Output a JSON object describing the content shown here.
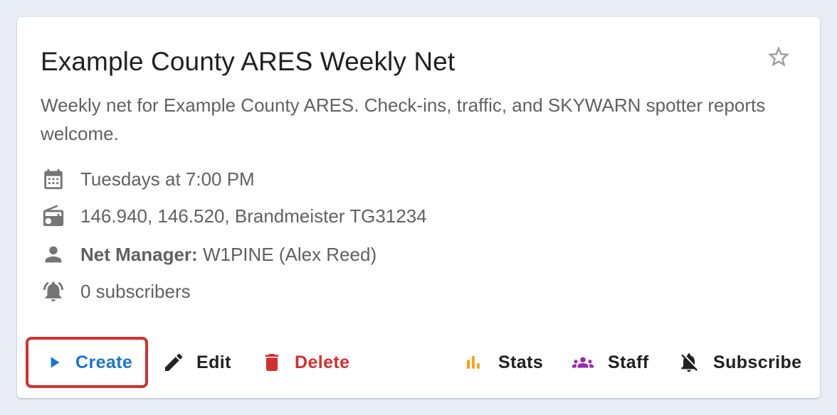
{
  "card": {
    "title": "Example County ARES Weekly Net",
    "description": "Weekly net for Example County ARES. Check-ins, traffic, and SKYWARN spotter reports welcome.",
    "schedule": "Tuesdays at 7:00 PM",
    "frequencies": "146.940, 146.520, Brandmeister TG31234",
    "manager_label": "Net Manager:",
    "manager_value": "W1PINE (Alex Reed)",
    "subscribers": "0 subscribers",
    "favorite_icon": "star-outline-icon"
  },
  "actions": {
    "create": "Create",
    "edit": "Edit",
    "delete": "Delete",
    "stats": "Stats",
    "staff": "Staff",
    "subscribe": "Subscribe"
  },
  "colors": {
    "primary": "#1976d2",
    "error": "#d32f2f",
    "stats": "#ff9800",
    "staff": "#9c27b0",
    "text_dark": "#212121",
    "text_muted": "#616161",
    "highlight_border": "#d32f2f"
  }
}
